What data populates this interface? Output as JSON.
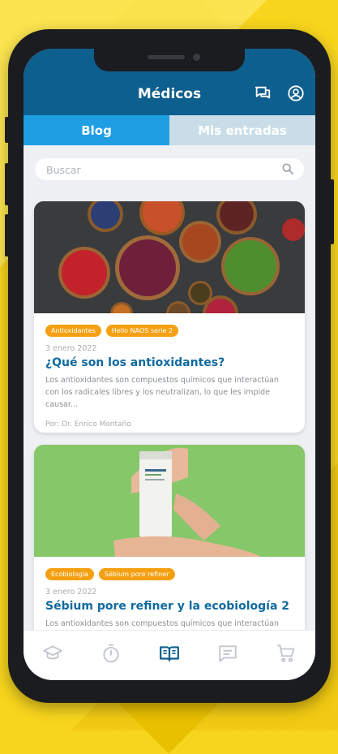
{
  "header": {
    "title": "Médicos",
    "icons": [
      "chat-icon",
      "user-icon"
    ]
  },
  "tabs": [
    {
      "label": "Blog",
      "active": true
    },
    {
      "label": "Mis entradas",
      "active": false
    }
  ],
  "search": {
    "placeholder": "Buscar",
    "value": ""
  },
  "posts": [
    {
      "tags": [
        "Antioxidantes",
        "Hello NAOS serie 2"
      ],
      "date": "3 enero 2022",
      "title": "¿Qué son los antioxidantes?",
      "excerpt": "Los antioxidantes son compuestos químicos que interactúan con los radicales libres y los neutralizan, lo que les impide causar...",
      "author": "Por: Dr. Enrico Montaño"
    },
    {
      "tags": [
        "Ecobiologia",
        "Sébium pore refiner"
      ],
      "date": "3 enero 2022",
      "title": "Sébium pore refiner y la ecobiología 2",
      "excerpt": "Los antioxidantes son compuestos químicos que interactúan con"
    }
  ],
  "bottom_nav": [
    {
      "icon": "graduation-cap-icon",
      "active": false
    },
    {
      "icon": "stopwatch-icon",
      "active": false
    },
    {
      "icon": "book-open-icon",
      "active": true
    },
    {
      "icon": "message-icon",
      "active": false
    },
    {
      "icon": "cart-icon",
      "active": false
    }
  ],
  "colors": {
    "header": "#0d5f8e",
    "tab_active": "#1f9ee4",
    "tab_inactive": "#c9dde8",
    "tag": "#f5a012",
    "title": "#0f6a9e",
    "background": "#f7d51d"
  }
}
